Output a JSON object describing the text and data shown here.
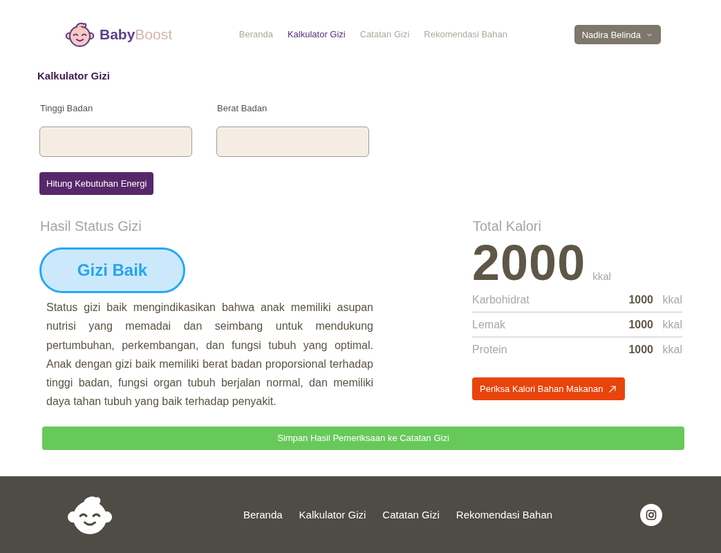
{
  "header": {
    "brand": "**Baby**Boost",
    "nav": [
      {
        "label": "Beranda",
        "selected": false
      },
      {
        "label": "Kalkulator Gizi",
        "selected": true
      },
      {
        "label": "Catatan Gizi",
        "selected": false
      },
      {
        "label": "Rekomendasi Bahan",
        "selected": false
      }
    ],
    "user_menu": {
      "label": "Nadira Belinda"
    }
  },
  "calculator": {
    "title": "Kalkulator Gizi",
    "fields": [
      {
        "label": "Tinggi Badan"
      },
      {
        "label": "Berat Badan"
      }
    ],
    "button": "Hitung Kebutuhan Energi"
  },
  "result": {
    "title": "Hasil Status Gizi",
    "status": "Gizi Baik",
    "description": "Status gizi baik mengindikasikan bahwa anak memiliki asupan nutrisi yang memadai dan seimbang untuk mendukung pertumbuhan, perkembangan, dan fungsi tubuh yang optimal. Anak dengan gizi baik memiliki berat badan proporsional terhadap tinggi badan, fungsi organ tubuh berjalan normal, dan memiliki daya tahan tubuh yang baik terhadap penyakit."
  },
  "calories": {
    "title": "Total Kalori",
    "total": "2000",
    "unit": "kkal",
    "rows": [
      {
        "label": "Karbohidrat",
        "value": "1000",
        "unit": "kkal"
      },
      {
        "label": "Lemak",
        "value": "1000",
        "unit": "kkal"
      },
      {
        "label": "Protein",
        "value": "1000",
        "unit": "kkal"
      }
    ],
    "button": "Periksa Kalori Bahan Makanan"
  },
  "save_button": "Simpan Hasil Pemeriksaan ke Catatan Gizi",
  "footer": {
    "nav": [
      "Beranda",
      "Kalkulator Gizi",
      "Catatan Gizi",
      "Rekomendasi Bahan"
    ]
  }
}
